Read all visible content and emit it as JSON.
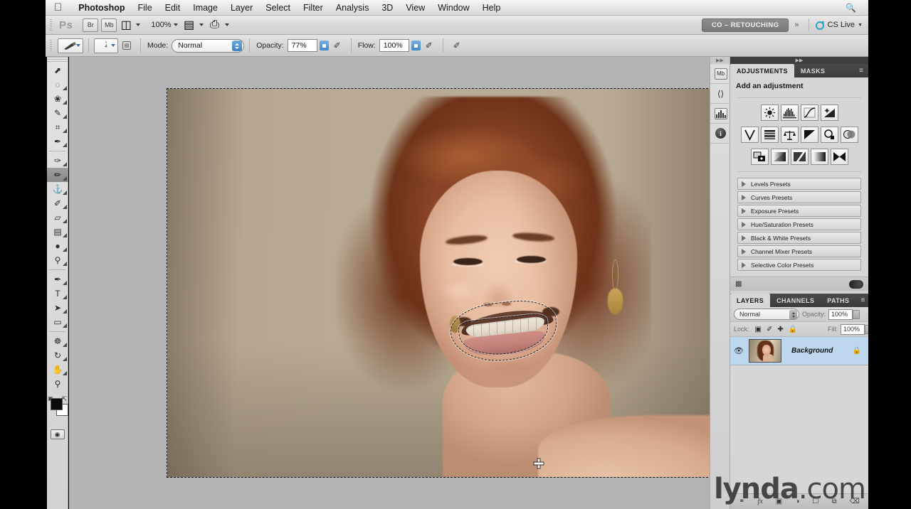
{
  "menubar": {
    "apple_icon": "apple-logo",
    "items": [
      {
        "label": "Photoshop",
        "bold": true
      },
      {
        "label": "File",
        "bold": false
      },
      {
        "label": "Edit",
        "bold": false
      },
      {
        "label": "Image",
        "bold": false
      },
      {
        "label": "Layer",
        "bold": false
      },
      {
        "label": "Select",
        "bold": false
      },
      {
        "label": "Filter",
        "bold": false
      },
      {
        "label": "Analysis",
        "bold": false
      },
      {
        "label": "3D",
        "bold": false
      },
      {
        "label": "View",
        "bold": false
      },
      {
        "label": "Window",
        "bold": false
      },
      {
        "label": "Help",
        "bold": false
      }
    ],
    "right_icons": [
      "search-icon"
    ]
  },
  "appbar": {
    "logo": "Ps",
    "bridge_icon": "Br",
    "minibridge_icon": "Mb",
    "view_extras_icon": "screen-mode-icon",
    "zoom_level": "100%",
    "arrange_icon": "arrange-documents-icon",
    "screenmode_icon": "screen-mode-icon",
    "workspace": "CO – RETOUCHING",
    "more_workspaces": "»",
    "cs_live": "CS Live"
  },
  "optionsbar": {
    "tool_preset_icon": "brush-tool-preset-icon",
    "brush_size": "4",
    "brush_panel_icon": "brush-panel-icon",
    "mode_label": "Mode:",
    "mode_value": "Normal",
    "opacity_label": "Opacity:",
    "opacity_value": "77%",
    "opacity_pressure_icon": "pressure-opacity-icon",
    "flow_label": "Flow:",
    "flow_value": "100%",
    "airbrush_icon": "airbrush-icon",
    "pressure_size_icon": "pressure-size-icon"
  },
  "toolbox": {
    "tools": [
      {
        "name": "move-tool",
        "glyph": "⬈",
        "active": false,
        "corner": false
      },
      {
        "name": "marquee-tool",
        "glyph": "◌",
        "active": false,
        "corner": true
      },
      {
        "name": "lasso-tool",
        "glyph": "❀",
        "active": false,
        "corner": true
      },
      {
        "name": "quick-selection-tool",
        "glyph": "✎",
        "active": false,
        "corner": true
      },
      {
        "name": "crop-tool",
        "glyph": "⌗",
        "active": false,
        "corner": true
      },
      {
        "name": "eyedropper-tool",
        "glyph": "✒",
        "active": false,
        "corner": true
      },
      {
        "divider": true
      },
      {
        "name": "spot-healing-brush-tool",
        "glyph": "✑",
        "active": false,
        "corner": true
      },
      {
        "name": "brush-tool",
        "glyph": "✏",
        "active": true,
        "corner": true
      },
      {
        "name": "clone-stamp-tool",
        "glyph": "⚓",
        "active": false,
        "corner": true
      },
      {
        "name": "history-brush-tool",
        "glyph": "✐",
        "active": false,
        "corner": true
      },
      {
        "name": "eraser-tool",
        "glyph": "▱",
        "active": false,
        "corner": true
      },
      {
        "name": "gradient-tool",
        "glyph": "▤",
        "active": false,
        "corner": true
      },
      {
        "name": "blur-tool",
        "glyph": "●",
        "active": false,
        "corner": true
      },
      {
        "name": "dodge-tool",
        "glyph": "⚲",
        "active": false,
        "corner": true
      },
      {
        "divider": true
      },
      {
        "name": "pen-tool",
        "glyph": "✒",
        "active": false,
        "corner": true
      },
      {
        "name": "type-tool",
        "glyph": "T",
        "active": false,
        "corner": true
      },
      {
        "name": "path-selection-tool",
        "glyph": "➤",
        "active": false,
        "corner": true
      },
      {
        "name": "rectangle-tool",
        "glyph": "▭",
        "active": false,
        "corner": true
      },
      {
        "divider": true
      },
      {
        "name": "3d-object-rotate-tool",
        "glyph": "☸",
        "active": false,
        "corner": true
      },
      {
        "name": "3d-camera-rotate-tool",
        "glyph": "↻",
        "active": false,
        "corner": true
      },
      {
        "name": "hand-tool",
        "glyph": "✋",
        "active": false,
        "corner": true
      },
      {
        "name": "zoom-tool",
        "glyph": "⚲",
        "active": false,
        "corner": false
      }
    ],
    "foreground_color": "#0b0b0b",
    "background_color": "#ffffff",
    "default_colors_icon": "default-colors-icon",
    "swap_colors_icon": "swap-colors-icon",
    "quickmask_icon": "quick-mask-icon"
  },
  "document": {
    "selection_active": true,
    "selection_name": "mouth-selection",
    "canvas_border": "select-all-marching-ants",
    "cursor": "precise-brush-crosshair"
  },
  "dockstrip": {
    "items": [
      {
        "name": "mini-bridge-icon",
        "glyph": "Mb"
      },
      {
        "name": "history-icon",
        "glyph": "⫨"
      },
      {
        "name": "histogram-icon",
        "glyph": "▤"
      },
      {
        "name": "info-icon",
        "glyph": "i"
      }
    ]
  },
  "adjustments_panel": {
    "tabs": [
      {
        "label": "ADJUSTMENTS",
        "active": true
      },
      {
        "label": "MASKS",
        "active": false
      }
    ],
    "menu_icon": "panel-menu-icon",
    "title": "Add an adjustment",
    "row1": [
      {
        "name": "brightness-contrast-icon",
        "glyph": "☀"
      },
      {
        "name": "levels-icon",
        "glyph": "▒"
      },
      {
        "name": "curves-icon",
        "glyph": "⌒"
      },
      {
        "name": "exposure-icon",
        "glyph": "◢"
      }
    ],
    "row2": [
      {
        "name": "vibrance-icon",
        "glyph": "V"
      },
      {
        "name": "hue-saturation-icon",
        "glyph": "≡"
      },
      {
        "name": "color-balance-icon",
        "glyph": "⚖"
      },
      {
        "name": "black-white-icon",
        "glyph": "◤"
      },
      {
        "name": "photo-filter-icon",
        "glyph": "◔"
      },
      {
        "name": "channel-mixer-icon",
        "glyph": "◑"
      }
    ],
    "row3": [
      {
        "name": "invert-icon",
        "glyph": "◨"
      },
      {
        "name": "posterize-icon",
        "glyph": "◧"
      },
      {
        "name": "threshold-icon",
        "glyph": "╱"
      },
      {
        "name": "gradient-map-icon",
        "glyph": "▦"
      },
      {
        "name": "selective-color-icon",
        "glyph": "⋈"
      }
    ],
    "presets": [
      "Levels Presets",
      "Curves Presets",
      "Exposure Presets",
      "Hue/Saturation Presets",
      "Black & White Presets",
      "Channel Mixer Presets",
      "Selective Color Presets"
    ],
    "footer": {
      "clip_layer_icon": "clip-to-layer-icon",
      "visibility_icon": "toggle-visibility-icon"
    }
  },
  "layers_panel": {
    "tabs": [
      {
        "label": "LAYERS",
        "active": true
      },
      {
        "label": "CHANNELS",
        "active": false
      },
      {
        "label": "PATHS",
        "active": false
      }
    ],
    "menu_icon": "panel-menu-icon",
    "blend_mode": "Normal",
    "opacity_label": "Opacity:",
    "opacity_value": "100%",
    "lock_label": "Lock:",
    "lock_icons": [
      {
        "name": "lock-transparent-pixels-icon",
        "glyph": "▨"
      },
      {
        "name": "lock-image-pixels-icon",
        "glyph": "✐"
      },
      {
        "name": "lock-position-icon",
        "glyph": "✛"
      },
      {
        "name": "lock-all-icon",
        "glyph": "■"
      }
    ],
    "fill_label": "Fill:",
    "fill_value": "100%",
    "layers": [
      {
        "name": "Background",
        "visible": true,
        "locked": true
      }
    ],
    "footer_icons": [
      {
        "name": "link-layers-icon",
        "glyph": "⚭"
      },
      {
        "name": "layer-style-icon",
        "glyph": "fx"
      },
      {
        "name": "add-layer-mask-icon",
        "glyph": "▣"
      },
      {
        "name": "new-adjustment-layer-icon",
        "glyph": "◑"
      },
      {
        "name": "new-group-icon",
        "glyph": "☐"
      },
      {
        "name": "new-layer-icon",
        "glyph": "⧉"
      },
      {
        "name": "delete-layer-icon",
        "glyph": "⌧"
      }
    ]
  },
  "watermark": {
    "brand": "lynda",
    "domain": ".com"
  }
}
